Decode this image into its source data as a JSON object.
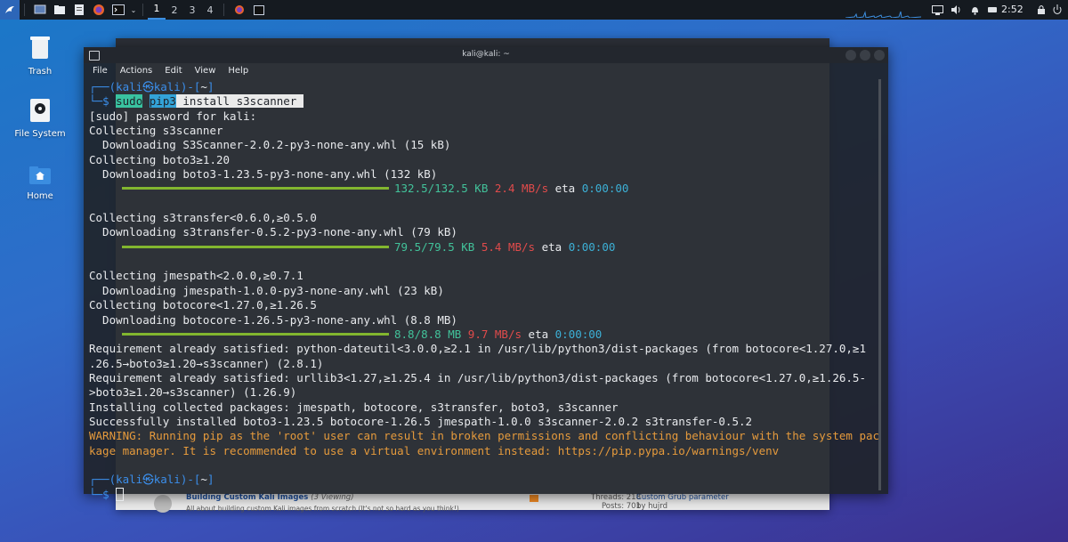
{
  "panel": {
    "workspaces": [
      "1",
      "2",
      "3",
      "4"
    ],
    "active_workspace": "1",
    "clock": "2:52"
  },
  "desktop": {
    "icons": [
      {
        "label": "Trash"
      },
      {
        "label": "File System"
      },
      {
        "label": "Home"
      }
    ]
  },
  "background_window": {
    "forums": [
      {
        "title": "Building Custom Kali Images",
        "viewing": "(3 Viewing)",
        "desc": "All about building custom Kali images from scratch (It's not so hard as you think!)",
        "threads": "Threads: 218",
        "posts": "Posts: 701",
        "last_post": "Custom Grub parameter",
        "last_by": "by hujrd"
      }
    ]
  },
  "terminal": {
    "title": "kali@kali: ~",
    "menu": [
      "File",
      "Actions",
      "Edit",
      "View",
      "Help"
    ],
    "prompt_user": "kali",
    "prompt_host": "kali",
    "prompt_dir": "~",
    "cmd_sudo": "sudo",
    "cmd_pip": "pip3",
    "cmd_rest": " install s3scanner ",
    "lines": {
      "l1": "[sudo] password for kali:",
      "l2": "Collecting s3scanner",
      "l3": "  Downloading S3Scanner-2.0.2-py3-none-any.whl (15 kB)",
      "l4": "Collecting boto3≥1.20",
      "l5": "  Downloading boto3-1.23.5-py3-none-any.whl (132 kB)",
      "p1_size": "132.5/132.5 KB",
      "p1_speed": "2.4 MB/s",
      "p1_eta": "0:00:00",
      "l6": "Collecting s3transfer<0.6.0,≥0.5.0",
      "l7": "  Downloading s3transfer-0.5.2-py3-none-any.whl (79 kB)",
      "p2_size": "79.5/79.5 KB",
      "p2_speed": "5.4 MB/s",
      "p2_eta": "0:00:00",
      "l8": "Collecting jmespath<2.0.0,≥0.7.1",
      "l9": "  Downloading jmespath-1.0.0-py3-none-any.whl (23 kB)",
      "l10": "Collecting botocore<1.27.0,≥1.26.5",
      "l11": "  Downloading botocore-1.26.5-py3-none-any.whl (8.8 MB)",
      "p3_size": "8.8/8.8 MB",
      "p3_speed": "9.7 MB/s",
      "p3_eta": "0:00:00",
      "l12": "Requirement already satisfied: python-dateutil<3.0.0,≥2.1 in /usr/lib/python3/dist-packages (from botocore<1.27.0,≥1",
      "l13": ".26.5→boto3≥1.20→s3scanner) (2.8.1)",
      "l14": "Requirement already satisfied: urllib3<1.27,≥1.25.4 in /usr/lib/python3/dist-packages (from botocore<1.27.0,≥1.26.5-",
      "l15": ">boto3≥1.20→s3scanner) (1.26.9)",
      "l16": "Installing collected packages: jmespath, botocore, s3transfer, boto3, s3scanner",
      "l17": "Successfully installed boto3-1.23.5 botocore-1.26.5 jmespath-1.0.0 s3scanner-2.0.2 s3transfer-0.5.2",
      "w1": "WARNING: Running pip as the 'root' user can result in broken permissions and conflicting behaviour with the system pac",
      "w2": "kage manager. It is recommended to use a virtual environment instead: https://pip.pypa.io/warnings/venv"
    },
    "prompt_symbol": "$"
  },
  "colors": {
    "prompt": "#3b8eea",
    "progress_bar": "#82b62f",
    "speed": "#e14b4b",
    "size": "#42c29a",
    "eta": "#3cb0d6",
    "warning": "#e59a3c"
  }
}
